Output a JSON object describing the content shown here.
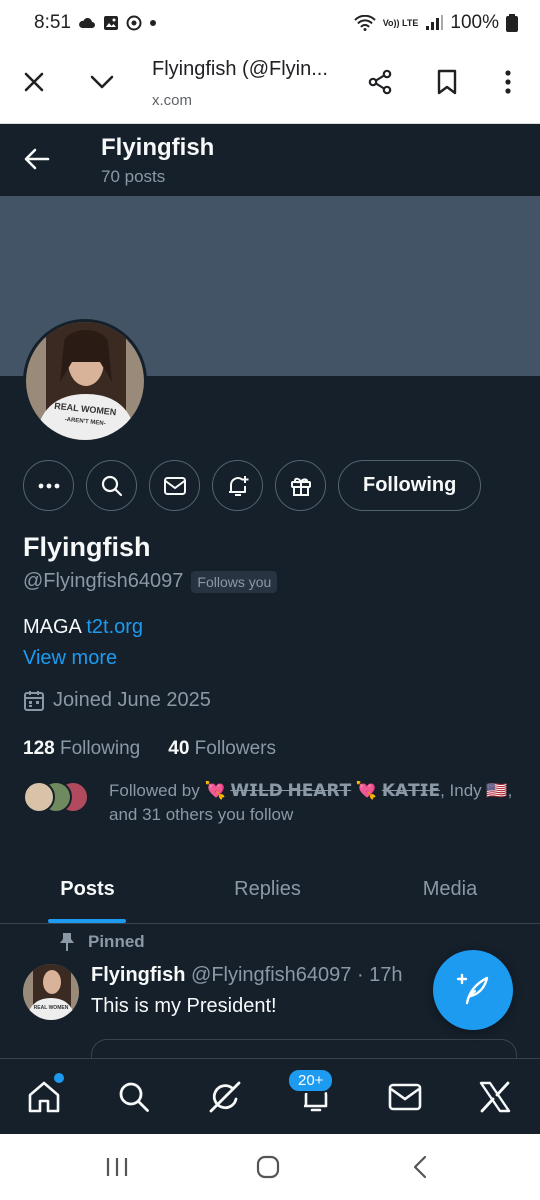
{
  "status_bar": {
    "time": "8:51",
    "battery": "100%",
    "volte": "Vo)) LTE"
  },
  "browser": {
    "title": "Flyingfish (@Flyin...",
    "url": "x.com"
  },
  "profile_header": {
    "name": "Flyingfish",
    "post_count": "70 posts"
  },
  "avatar_shirt_text": "REAL WOMEN AREN'T MEN",
  "actions": {
    "following_label": "Following"
  },
  "profile": {
    "display_name": "Flyingfish",
    "handle": "@Flyingfish64097",
    "follows_you": "Follows you",
    "bio_text": "MAGA ",
    "bio_link": "t2t.org",
    "view_more": "View more",
    "joined": "Joined June 2025",
    "following_count": "128",
    "following_label": "Following",
    "followers_count": "40",
    "followers_label": "Followers",
    "followed_by_prefix": "Followed by ",
    "followed_by_name1": "𝗪𝗜𝗟𝗗 𝗛𝗘𝗔𝗥𝗧",
    "followed_by_name2": "𝗞𝗔𝗧𝗜𝗘",
    "followed_by_name3": ", Indy ",
    "followed_by_suffix": "and 31 others you follow"
  },
  "tabs": [
    {
      "label": "Posts",
      "active": true
    },
    {
      "label": "Replies",
      "active": false
    },
    {
      "label": "Media",
      "active": false
    }
  ],
  "pinned_post": {
    "pinned_label": "Pinned",
    "author": "Flyingfish",
    "meta": "@Flyingfish64097 · 17h",
    "text": "This is my President!"
  },
  "bottom_nav": {
    "notifications_badge": "20+"
  },
  "colors": {
    "bg": "#15202b",
    "banner": "#425466",
    "accent": "#1d9bf0",
    "muted": "#8b98a5"
  }
}
